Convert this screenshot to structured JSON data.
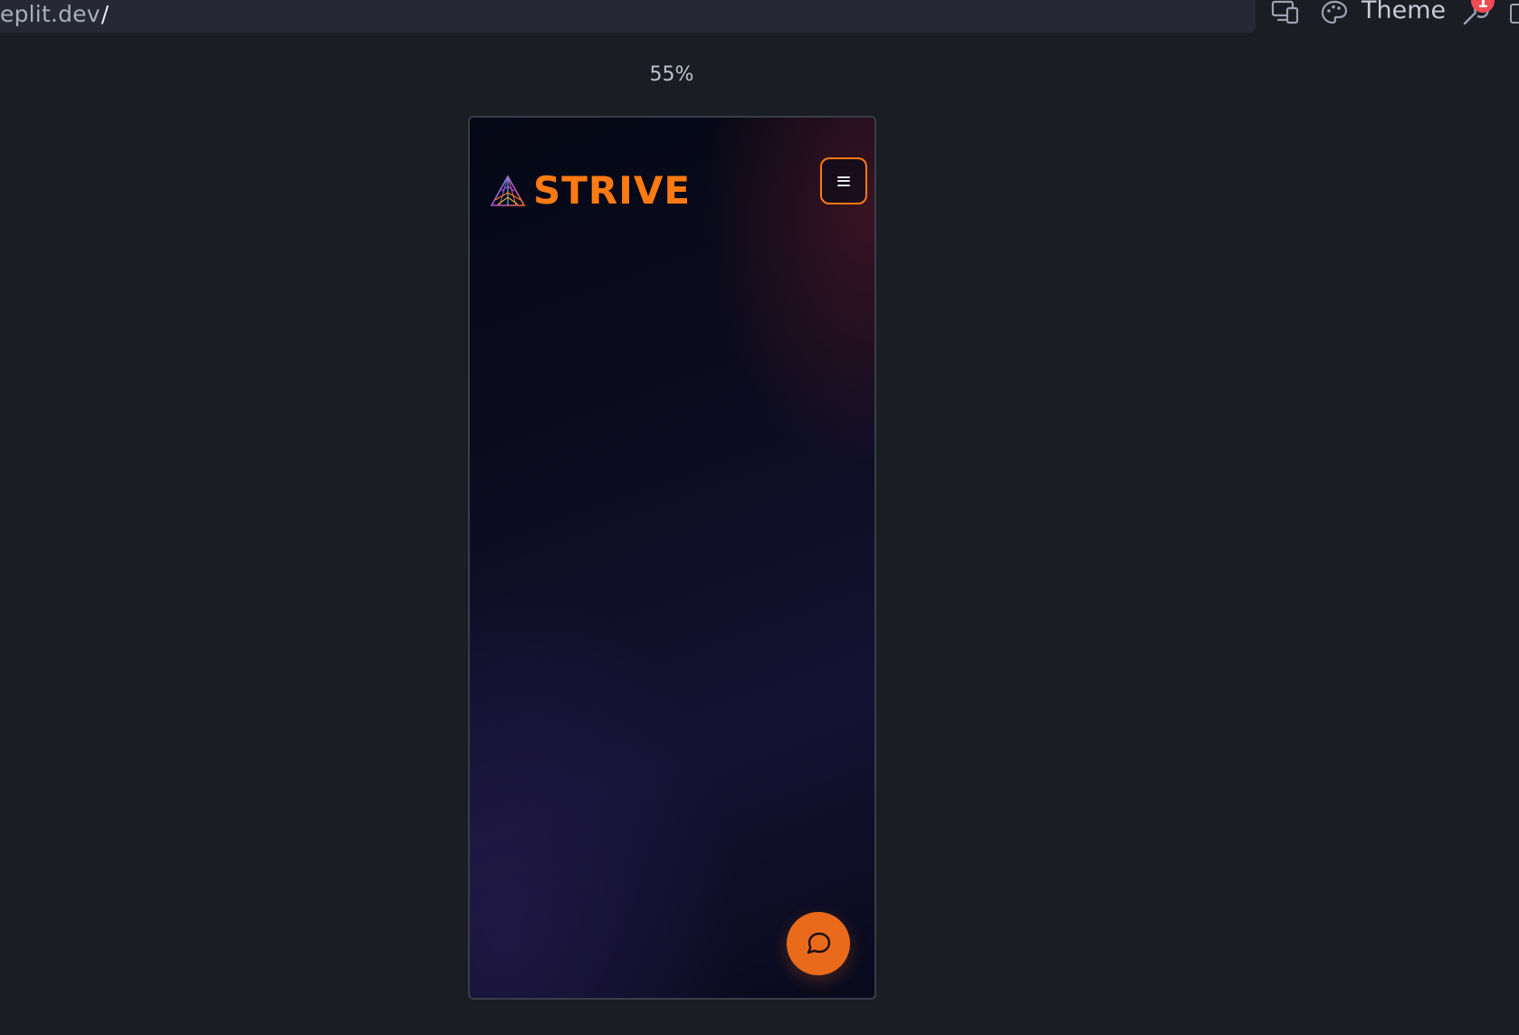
{
  "address_bar": {
    "url_text": "eplit.dev",
    "url_tail": "/"
  },
  "toolbar": {
    "theme_label": "Theme",
    "notification_count": "1",
    "icons": [
      "devices-icon",
      "palette-icon",
      "wrench-icon",
      "panel-icon"
    ]
  },
  "preview": {
    "zoom_label": "55%",
    "site": {
      "logo_text": "STRIVE",
      "menu_icon": "hamburger-menu-icon",
      "chat_icon": "chat-bubble-icon"
    }
  },
  "colors": {
    "accent": "#ff7a12",
    "fab": "#ea6a1c",
    "badge": "#f24b55",
    "background": "#1b1d25"
  }
}
